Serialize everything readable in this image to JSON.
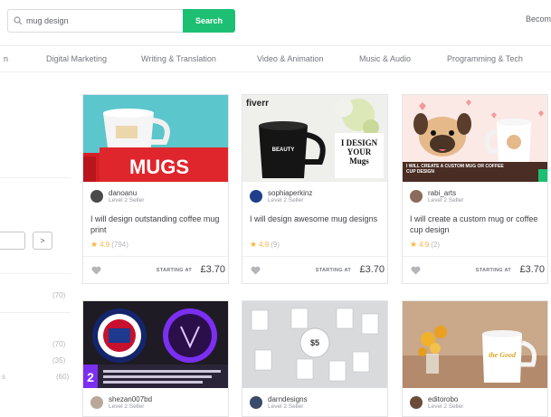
{
  "search": {
    "value": "mug design",
    "button": "Search"
  },
  "header": {
    "become_seller": "Becom"
  },
  "categories": [
    {
      "label": "n"
    },
    {
      "label": "Digital Marketing"
    },
    {
      "label": "Writing & Translation"
    },
    {
      "label": "Video & Animation"
    },
    {
      "label": "Music & Audio"
    },
    {
      "label": "Programming & Tech"
    }
  ],
  "sidebar": {
    "pager_next": ">",
    "counts": [
      "(70)",
      "(70)",
      "(35)",
      "(60)"
    ],
    "fragment": "s"
  },
  "gigs": [
    {
      "seller": "danoanu",
      "level": "Level 2 Seller",
      "title": "I will design outstanding coffee mug print",
      "score": "4.9",
      "reviews": "(794)",
      "starting": "STARTING AT",
      "price": "£3.70",
      "thumb_text": "MUGS"
    },
    {
      "seller": "sophiaperkinz",
      "level": "Level 2 Seller",
      "title": "I will design awesome mug designs",
      "score": "4.9",
      "reviews": "(9)",
      "starting": "STARTING AT",
      "price": "£3.70",
      "thumb_brand": "fiverr",
      "thumb_mug_text": "BEAUTY",
      "thumb_card_text": "I DESIGN YOUR Mugs"
    },
    {
      "seller": "rabi_arts",
      "level": "Level 2 Seller",
      "title": "I will create a custom mug or coffee cup design",
      "score": "4.9",
      "reviews": "(2)",
      "starting": "STARTING AT",
      "price": "£3.70",
      "thumb_text": "I WILL CREATE A CUSTOM MUG OR COFFEE CUP DESIGN"
    },
    {
      "seller": "shezan007bd",
      "level": "Level 2 Seller",
      "thumb_badge": "2"
    },
    {
      "seller": "darndesigns",
      "level": "Level 2 Seller",
      "thumb_text": "$5"
    },
    {
      "seller": "editorobo",
      "level": "Level 2 Seller",
      "thumb_text": "the Good"
    }
  ],
  "colors": {
    "accent": "#1dbf73",
    "star": "#ffb33e",
    "badge": "#7b2ff2"
  }
}
